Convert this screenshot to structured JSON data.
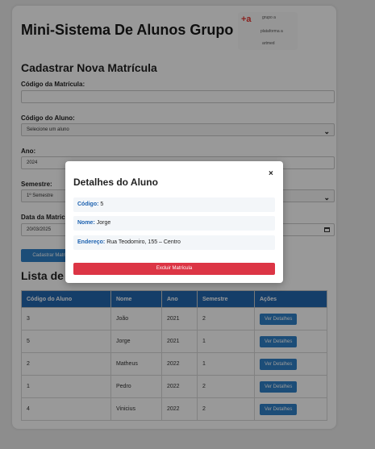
{
  "app": {
    "title": "Mini-Sistema De Alunos Grupo +A"
  },
  "logo": {
    "mark": "+a",
    "lines": [
      "grupo a",
      "plataforma a",
      "artmed"
    ]
  },
  "form": {
    "title": "Cadastrar Nova Matrícula",
    "codigo_matricula": {
      "label": "Código da Matrícula:",
      "value": ""
    },
    "codigo_aluno": {
      "label": "Código do Aluno:",
      "value": "Selecione um aluno"
    },
    "ano": {
      "label": "Ano:",
      "value": "2024"
    },
    "semestre": {
      "label": "Semestre:",
      "value": "1º Semestre"
    },
    "data": {
      "label": "Data da Matrícula:",
      "label_visible": "Data da Matric",
      "value": "20/03/2025"
    },
    "submit_label": "Cadastrar Matrícula",
    "submit_visible": "Cadastrar Matri"
  },
  "list": {
    "title": "Lista de Matrículas",
    "title_visible": "Lista de M",
    "columns": [
      "Código do Aluno",
      "Nome",
      "Ano",
      "Semestre",
      "Ações"
    ],
    "action_label": "Ver Detalhes",
    "rows": [
      {
        "codigo": "3",
        "nome": "João",
        "ano": "2021",
        "semestre": "2"
      },
      {
        "codigo": "5",
        "nome": "Jorge",
        "ano": "2021",
        "semestre": "1"
      },
      {
        "codigo": "2",
        "nome": "Matheus",
        "ano": "2022",
        "semestre": "1"
      },
      {
        "codigo": "1",
        "nome": "Pedro",
        "ano": "2022",
        "semestre": "2"
      },
      {
        "codigo": "4",
        "nome": "Vinicius",
        "ano": "2022",
        "semestre": "2"
      }
    ]
  },
  "modal": {
    "title": "Detalhes do Aluno",
    "close": "×",
    "codigo_label": "Código:",
    "codigo_value": "5",
    "nome_label": "Nome:",
    "nome_value": "Jorge",
    "endereco_label": "Endereço:",
    "endereco_value": "Rua Teodomiro, 155 – Centro",
    "delete_label": "Excluir Matrícula"
  },
  "colors": {
    "primary": "#2f80c8",
    "table_header": "#2468b0",
    "danger": "#dc3545",
    "key_text": "#1d62b0"
  }
}
